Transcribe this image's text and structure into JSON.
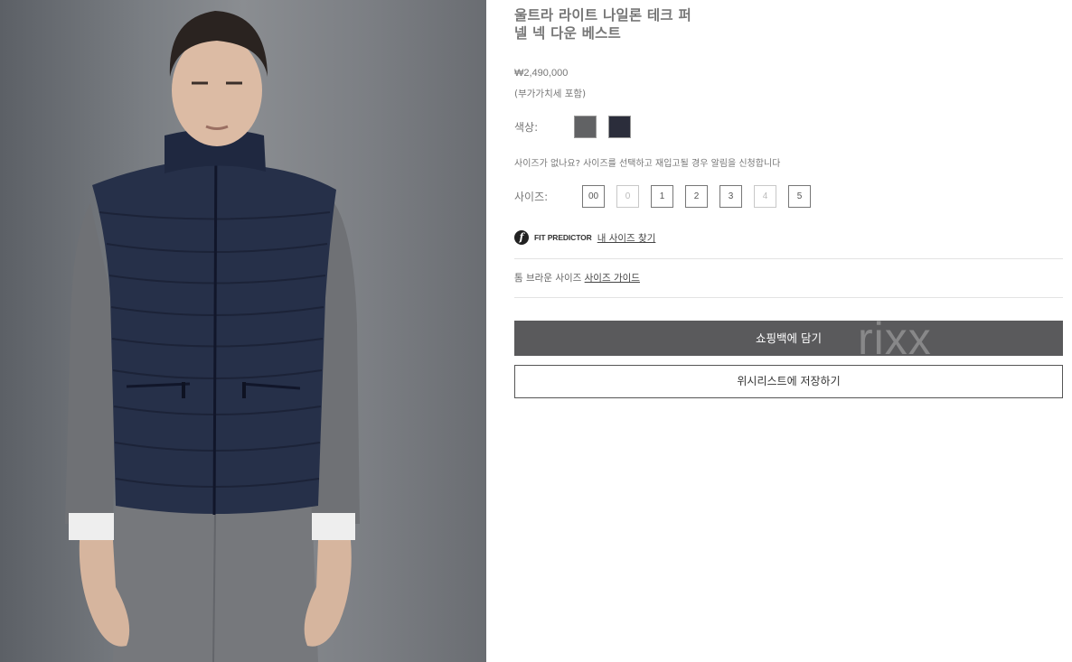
{
  "product": {
    "title_line1": "울트라 라이트 나일론 테크 퍼",
    "title_line2": "넬 넥 다운 베스트",
    "price": "₩2,490,000",
    "vat_note": "(부가가치세 포함)"
  },
  "color": {
    "label": "색상:",
    "swatches": [
      {
        "name": "grey",
        "color": "#616264"
      },
      {
        "name": "navy",
        "color": "#2b2d3b"
      }
    ]
  },
  "notify_text": "사이즈가 없나요? 사이즈를 선택하고 재입고될 경우 알림을 신청합니다",
  "size": {
    "label": "사이즈:",
    "options": [
      {
        "label": "00",
        "available": true
      },
      {
        "label": "0",
        "available": false
      },
      {
        "label": "1",
        "available": true
      },
      {
        "label": "2",
        "available": true
      },
      {
        "label": "3",
        "available": true
      },
      {
        "label": "4",
        "available": false
      },
      {
        "label": "5",
        "available": true
      }
    ]
  },
  "fit_predictor": {
    "logo": "f",
    "brand": "FIT PREDICTOR",
    "link": "내 사이즈 찾기"
  },
  "size_guide": {
    "prefix": "톰 브라운 사이즈",
    "link": "사이즈 가이드"
  },
  "buttons": {
    "add_to_bag": "쇼핑백에 담기",
    "wishlist": "위시리스트에 저장하기"
  },
  "watermark": "rixx"
}
